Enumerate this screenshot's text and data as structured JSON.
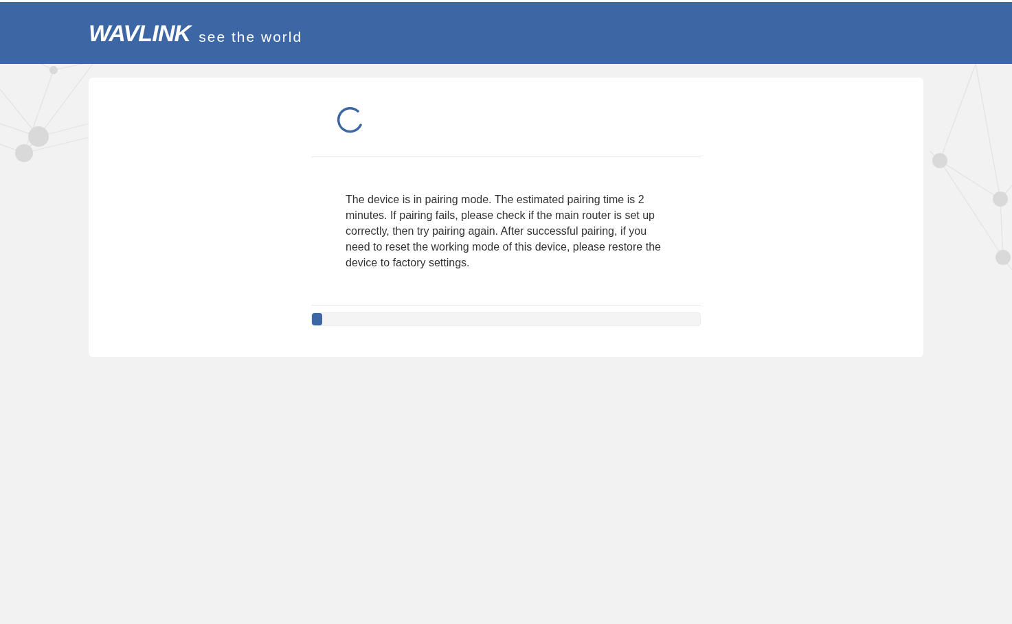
{
  "header": {
    "logo": "WAVLINK",
    "tagline": "see the world"
  },
  "pairing": {
    "message": "The device is in pairing mode. The estimated pairing time is 2 minutes. If pairing fails, please check if the main router is set up correctly, then try pairing again. After successful pairing, if you need to reset the working mode of this device, please restore the device to factory settings.",
    "progress": {
      "level": 0.026
    }
  }
}
